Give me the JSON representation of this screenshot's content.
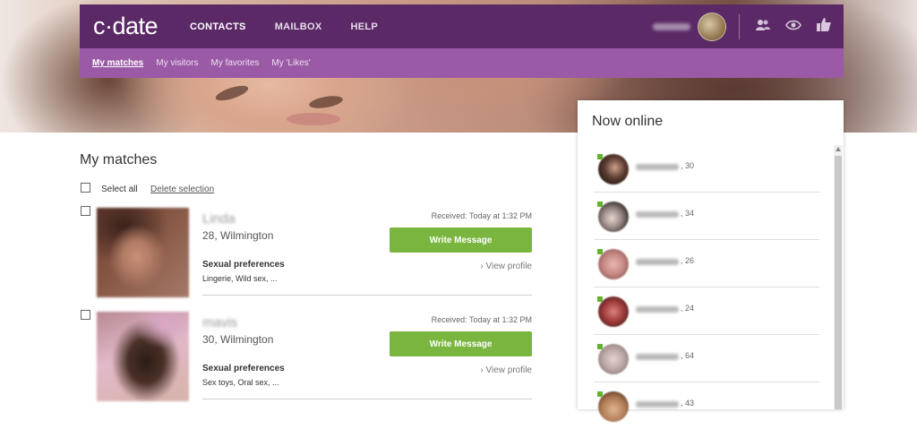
{
  "app": {
    "logo_text": "c·date"
  },
  "nav": {
    "items": [
      "CONTACTS",
      "MAILBOX",
      "HELP"
    ],
    "active": "CONTACTS",
    "icons": [
      "contacts-icon",
      "visitors-eye-icon",
      "likes-thumb-icon"
    ]
  },
  "subnav": {
    "items": [
      "My matches",
      "My visitors",
      "My favorites",
      "My 'Likes'"
    ],
    "active": "My matches"
  },
  "main": {
    "title": "My matches",
    "select_all": "Select all",
    "delete_selection": "Delete selection",
    "matches": [
      {
        "name": "Linda",
        "age_location": "28, Wilmington",
        "received": "Received: Today at 1:32 PM",
        "button": "Write Message",
        "view_profile": "› View profile",
        "pref_heading": "Sexual preferences",
        "preferences": "Lingerie, Wild sex, ..."
      },
      {
        "name": "mavis",
        "age_location": "30, Wilmington",
        "received": "Received: Today at 1:32 PM",
        "button": "Write Message",
        "view_profile": "› View profile",
        "pref_heading": "Sexual preferences",
        "preferences": "Sex toys, Oral sex, ..."
      }
    ]
  },
  "online": {
    "title": "Now online",
    "users": [
      {
        "age": ", 30"
      },
      {
        "age": ", 34"
      },
      {
        "age": ", 26"
      },
      {
        "age": ", 24"
      },
      {
        "age": ", 64"
      },
      {
        "age": ", 43"
      }
    ]
  },
  "colors": {
    "nav_bg": "#5b2a66",
    "subnav_bg": "#9b5aa6",
    "button_green": "#7ab63f",
    "online_dot": "#62b32e"
  }
}
